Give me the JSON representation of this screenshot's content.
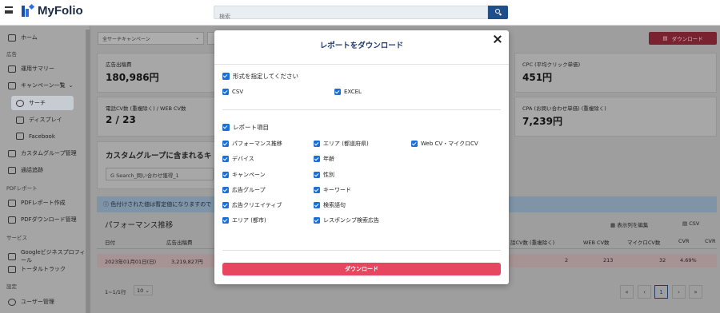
{
  "app": {
    "title": "MyFolio"
  },
  "search": {
    "placeholder": "検索"
  },
  "sidebar": {
    "home": "ホーム",
    "section_ads": "広告",
    "summary": "運用サマリー",
    "campaigns": "キャンペーン一覧",
    "search": "サーチ",
    "display": "ディスプレイ",
    "facebook": "Facebook",
    "custom_group": "カスタムグループ管理",
    "call_tracking": "通話追跡",
    "section_pdf": "PDFレポート",
    "pdf_create": "PDFレポート作成",
    "pdf_download": "PDFダウンロード管理",
    "section_service": "サービス",
    "gbp": "Googleビジネスプロフィール",
    "total_track": "トータルトラック",
    "section_settings": "設定",
    "users": "ユーザー管理"
  },
  "background": {
    "campaign_dropdown": "全サーチキャンペーン",
    "download_button": "ダウンロード",
    "kpi": [
      {
        "label": "広告出稿費",
        "value": "180,986円"
      },
      {
        "label": "CPC (平均クリック単価)",
        "value": "451円"
      },
      {
        "label": "電話CV数 (重複除く) / WEB CV数",
        "value": "2 / 23"
      },
      {
        "label": "CPA (お問い合わせ単価) (重複除く)",
        "value": "7,239円"
      }
    ],
    "custom_group_title": "カスタムグループに含まれるキ",
    "custom_group_chip": "Search_問い合わせ獲得_1",
    "info_text": "色付けされた値は暫定値になりますので",
    "perf_title": "パフォーマンス推移",
    "edit_columns": "表示列を編集",
    "csv": "CSV",
    "table_headers": [
      "日付",
      "広告出稿費",
      "話CV数 (重複除く)",
      "WEB CV数",
      "マイクロCV数",
      "CVR",
      "CVR"
    ],
    "table_row": [
      "2023年01月01日(日)",
      "3,219,827円",
      "2",
      "213",
      "32",
      "4.69%"
    ],
    "rows_label": "1~1/1行",
    "rows_per_page": "10",
    "page": "1"
  },
  "modal": {
    "title": "レポートをダウンロード",
    "format_label": "形式を指定してください",
    "formats": [
      "CSV",
      "EXCEL"
    ],
    "items_label": "レポート項目",
    "items": [
      "パフォーマンス推移",
      "エリア (都道府県)",
      "Web CV・マイクロCV",
      "デバイス",
      "年齢",
      "キャンペーン",
      "性別",
      "広告グループ",
      "キーワード",
      "広告クリエイティブ",
      "検索語句",
      "エリア (都市)",
      "レスポンシブ検索広告"
    ],
    "download_button": "ダウンロード"
  },
  "colors": {
    "accent": "#e84660",
    "checkbox": "#1a6fd8",
    "title": "#1f3b6e"
  }
}
